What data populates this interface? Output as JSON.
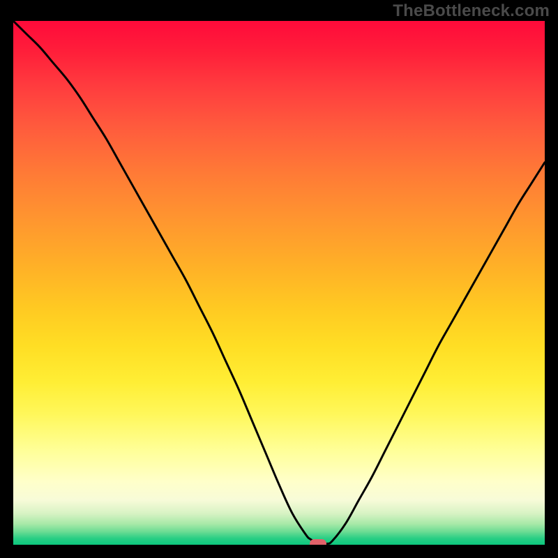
{
  "watermark": "TheBottleneck.com",
  "colors": {
    "frame": "#000000",
    "curve": "#000000",
    "marker": "#e2626a"
  },
  "chart_data": {
    "type": "line",
    "title": "",
    "xlabel": "",
    "ylabel": "",
    "xlim": [
      0,
      100
    ],
    "ylim": [
      0,
      100
    ],
    "series": [
      {
        "name": "bottleneck-curve",
        "x": [
          0,
          2.5,
          5,
          7.5,
          10,
          12.5,
          15,
          17.5,
          20,
          22.5,
          25,
          27.5,
          30,
          32.5,
          35,
          37.5,
          40,
          42.5,
          45,
          47.5,
          50,
          52.5,
          55,
          56,
          57.5,
          59,
          60,
          62.5,
          65,
          67.5,
          70,
          72.5,
          75,
          77.5,
          80,
          82.5,
          85,
          87.5,
          90,
          92.5,
          95,
          97.5,
          100
        ],
        "y": [
          100,
          97.5,
          95,
          92,
          89,
          85.5,
          81.5,
          77.5,
          73,
          68.5,
          64,
          59.5,
          55,
          50.5,
          45.5,
          40.5,
          35,
          29.5,
          23.5,
          17.5,
          11.5,
          6,
          2,
          1,
          0.2,
          0.2,
          0.7,
          4,
          8.5,
          13,
          18,
          23,
          28,
          33,
          38,
          42.5,
          47,
          51.5,
          56,
          60.5,
          65,
          69,
          73
        ]
      }
    ],
    "flat_segment": {
      "x_start": 55,
      "x_end": 59
    },
    "marker": {
      "x": 57.3,
      "y": 0
    },
    "background_gradient": {
      "direction": "vertical",
      "stops": [
        {
          "pos": 0.0,
          "color": "#ff0a3a"
        },
        {
          "pos": 0.2,
          "color": "#ff5a3d"
        },
        {
          "pos": 0.4,
          "color": "#ffa02c"
        },
        {
          "pos": 0.6,
          "color": "#ffdc24"
        },
        {
          "pos": 0.8,
          "color": "#ffff90"
        },
        {
          "pos": 0.93,
          "color": "#ecf8d0"
        },
        {
          "pos": 1.0,
          "color": "#0cc87e"
        }
      ]
    }
  }
}
